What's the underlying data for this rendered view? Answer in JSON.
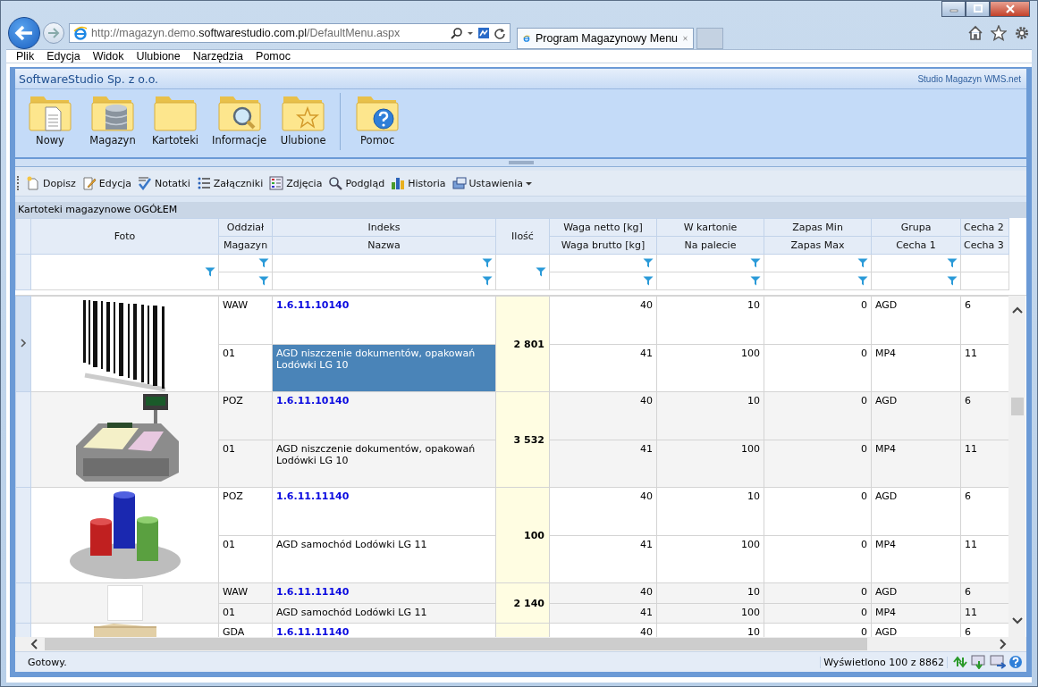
{
  "browser": {
    "address": {
      "start": "http://magazyn.demo.",
      "domain": "softwarestudio.com.pl",
      "path": "/DefaultMenu.aspx"
    },
    "tabs": [
      {
        "title": "Program Magazynowy Menu",
        "selected": true
      }
    ]
  },
  "menu": [
    "Plik",
    "Edycja",
    "Widok",
    "Ulubione",
    "Narzędzia",
    "Pomoc"
  ],
  "app": {
    "company": "SoftwareStudio Sp. z o.o.",
    "product": "Studio Magazyn WMS.net"
  },
  "ribbon": {
    "groups": [
      [
        {
          "label": "Nowy"
        },
        {
          "label": "Magazyn"
        },
        {
          "label": "Kartoteki"
        },
        {
          "label": "Informacje"
        },
        {
          "label": "Ulubione"
        }
      ],
      [
        {
          "label": "Pomoc"
        }
      ]
    ]
  },
  "toolbar": [
    {
      "label": "Dopisz",
      "kind": "button"
    },
    {
      "label": "Edycja",
      "kind": "button"
    },
    {
      "label": "Notatki",
      "kind": "button"
    },
    {
      "label": "Załączniki",
      "kind": "button"
    },
    {
      "label": "Zdjęcia",
      "kind": "button"
    },
    {
      "label": "Podgląd",
      "kind": "button"
    },
    {
      "label": "Historia",
      "kind": "button"
    },
    {
      "label": "Ustawienia",
      "kind": "dropdown"
    }
  ],
  "grid": {
    "caption": "Kartoteki magazynowe OGÓŁEM",
    "columns": [
      {
        "kind": "single",
        "label": "Foto",
        "filter": true
      },
      {
        "kind": "double",
        "top": "Oddział",
        "bottom": "Magazyn",
        "filter": true
      },
      {
        "kind": "double",
        "top": "Indeks",
        "bottom": "Nazwa",
        "filter": true
      },
      {
        "kind": "single",
        "label": "Ilość",
        "filter": true
      },
      {
        "kind": "double",
        "top": "Waga netto [kg]",
        "bottom": "Waga brutto [kg]",
        "filter": true
      },
      {
        "kind": "double",
        "top": "W kartonie",
        "bottom": "Na palecie",
        "filter": true
      },
      {
        "kind": "double",
        "top": "Zapas Min",
        "bottom": "Zapas Max",
        "filter": true
      },
      {
        "kind": "double",
        "top": "Grupa",
        "bottom": "Cecha 1",
        "filter": true
      },
      {
        "kind": "double",
        "top": "Cecha 2",
        "bottom": "Cecha 3",
        "filter": false
      }
    ],
    "rows": [
      {
        "current": true,
        "photo": {
          "kind": "picture"
        },
        "quantity": "2 801",
        "name_selected": true,
        "upper": [
          "WAW",
          "1.6.11.10140",
          "40",
          "10",
          "0",
          "AGD",
          "6"
        ],
        "lower": [
          "01",
          "AGD niszczenie dokumentów, opakowań Lodówki LG 10",
          "41",
          "100",
          "0",
          "MP4",
          "11"
        ]
      },
      {
        "current": false,
        "photo": {
          "kind": "picture"
        },
        "quantity": "3 532",
        "name_selected": false,
        "upper": [
          "POZ",
          "1.6.11.10140",
          "40",
          "10",
          "0",
          "AGD",
          "6"
        ],
        "lower": [
          "01",
          "AGD niszczenie dokumentów, opakowań Lodówki LG 10",
          "41",
          "100",
          "0",
          "MP4",
          "11"
        ]
      },
      {
        "current": false,
        "photo": {
          "kind": "picture"
        },
        "quantity": "100",
        "name_selected": false,
        "upper": [
          "POZ",
          "1.6.11.11140",
          "40",
          "10",
          "0",
          "AGD",
          "6"
        ],
        "lower": [
          "01",
          "AGD samochód Lodówki LG 11",
          "41",
          "100",
          "0",
          "MP4",
          "11"
        ]
      },
      {
        "current": false,
        "photo": {
          "kind": "blank"
        },
        "quantity": "2 140",
        "name_selected": false,
        "upper": [
          "WAW",
          "1.6.11.11140",
          "40",
          "10",
          "0",
          "AGD",
          "6"
        ],
        "lower": [
          "01",
          "AGD samochód Lodówki LG 11",
          "41",
          "100",
          "0",
          "MP4",
          "11"
        ]
      },
      {
        "current": false,
        "photo": {
          "kind": "picture"
        },
        "upper": [
          "GDA",
          "1.6.11.11140",
          "40",
          "10",
          "0",
          "AGD",
          "6"
        ]
      }
    ]
  },
  "status_bar": {
    "message": "Gotowy.",
    "count": "Wyświetlono 100 z 8862"
  }
}
